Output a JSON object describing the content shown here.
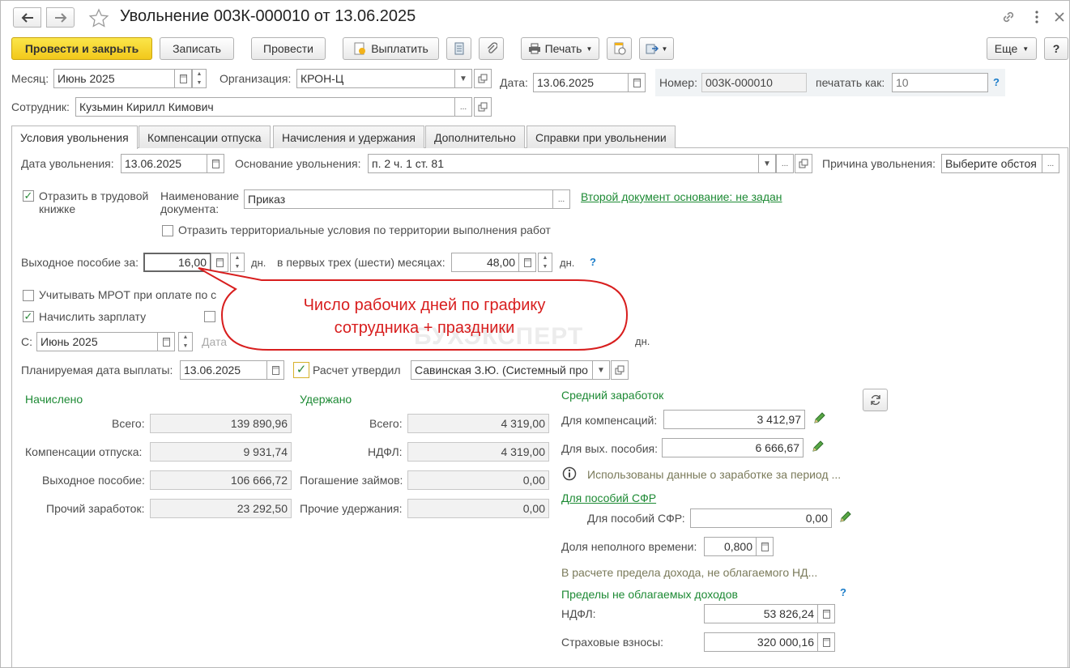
{
  "window": {
    "title": "Увольнение 003К-000010 от 13.06.2025"
  },
  "toolbar": {
    "post_close": "Провести и закрыть",
    "save": "Записать",
    "post": "Провести",
    "pay": "Выплатить",
    "print": "Печать",
    "more": "Еще",
    "help": "?"
  },
  "header": {
    "month_label": "Месяц:",
    "month_value": "Июнь 2025",
    "org_label": "Организация:",
    "org_value": "КРОН-Ц",
    "date_label": "Дата:",
    "date_value": "13.06.2025",
    "number_label": "Номер:",
    "number_value": "003К-000010",
    "print_as_label": "печатать как:",
    "print_as_placeholder": "10",
    "employee_label": "Сотрудник:",
    "employee_value": "Кузьмин Кирилл Кимович"
  },
  "tabs": [
    "Условия увольнения",
    "Компенсации отпуска",
    "Начисления и удержания",
    "Дополнительно",
    "Справки при увольнении"
  ],
  "conditions": {
    "dismissal_date_label": "Дата увольнения:",
    "dismissal_date": "13.06.2025",
    "basis_label": "Основание увольнения:",
    "basis_value": "п. 2 ч. 1 ст. 81",
    "reason_label": "Причина увольнения:",
    "reason_value": "Выберите обстоя",
    "workbook_label_1": "Отразить в трудовой",
    "workbook_label_2": "книжке",
    "doc_name_label_1": "Наименование",
    "doc_name_label_2": "документа:",
    "doc_name_value": "Приказ",
    "second_doc_link": "Второй документ основание: не задан",
    "territorial_label": "Отразить территориальные условия по территории выполнения работ",
    "severance_label": "Выходное пособие за:",
    "severance_days": "16,00",
    "days_unit": "дн.",
    "first_months_label": "в первых трех (шести) месяцах:",
    "first_months_days": "48,00",
    "mrot_label": "Учитывать МРОТ при оплате по с",
    "accrue_salary_label": "Начислить зарплату",
    "from_label": "С:",
    "from_value": "Июнь 2025",
    "date_partial_label": "Дата",
    "planned_date_label": "Планируемая дата выплаты:",
    "planned_date": "13.06.2025",
    "approved_label": "Расчет утвердил",
    "approved_value": "Савинская З.Ю. (Системный про"
  },
  "callout": {
    "line1": "Число рабочих дней по графику",
    "line2": "сотрудника + праздники",
    "watermark": "БУХЭКСПЕРТ"
  },
  "accrued": {
    "heading": "Начислено",
    "rows": [
      {
        "label": "Всего:",
        "value": "139 890,96"
      },
      {
        "label": "Компенсации отпуска:",
        "value": "9 931,74"
      },
      {
        "label": "Выходное пособие:",
        "value": "106 666,72"
      },
      {
        "label": "Прочий заработок:",
        "value": "23 292,50"
      }
    ]
  },
  "withheld": {
    "heading": "Удержано",
    "rows": [
      {
        "label": "Всего:",
        "value": "4 319,00"
      },
      {
        "label": "НДФЛ:",
        "value": "4 319,00"
      },
      {
        "label": "Погашение займов:",
        "value": "0,00"
      },
      {
        "label": "Прочие удержания:",
        "value": "0,00"
      }
    ]
  },
  "avg": {
    "heading": "Средний заработок",
    "comp_label": "Для компенсаций:",
    "comp_value": "3 412,97",
    "sev_label": "Для вых. пособия:",
    "sev_value": "6 666,67",
    "info_text": "Использованы данные о заработке за период ...",
    "sfr_link": "Для пособий СФР",
    "sfr_label": "Для пособий СФР:",
    "sfr_value": "0,00",
    "part_time_label": "Доля неполного времени:",
    "part_time_value": "0,800",
    "income_limit_text": "В расчете предела дохода, не облагаемого НД...",
    "limits_heading": "Пределы не облагаемых доходов",
    "ndfl_label": "НДФЛ:",
    "ndfl_value": "53 826,24",
    "insurance_label": "Страховые взносы:",
    "insurance_value": "320 000,16"
  },
  "colors": {
    "accent_green": "#1d8a34",
    "primary_yellow": "#f5d32b",
    "callout_red": "#d81e1e"
  }
}
